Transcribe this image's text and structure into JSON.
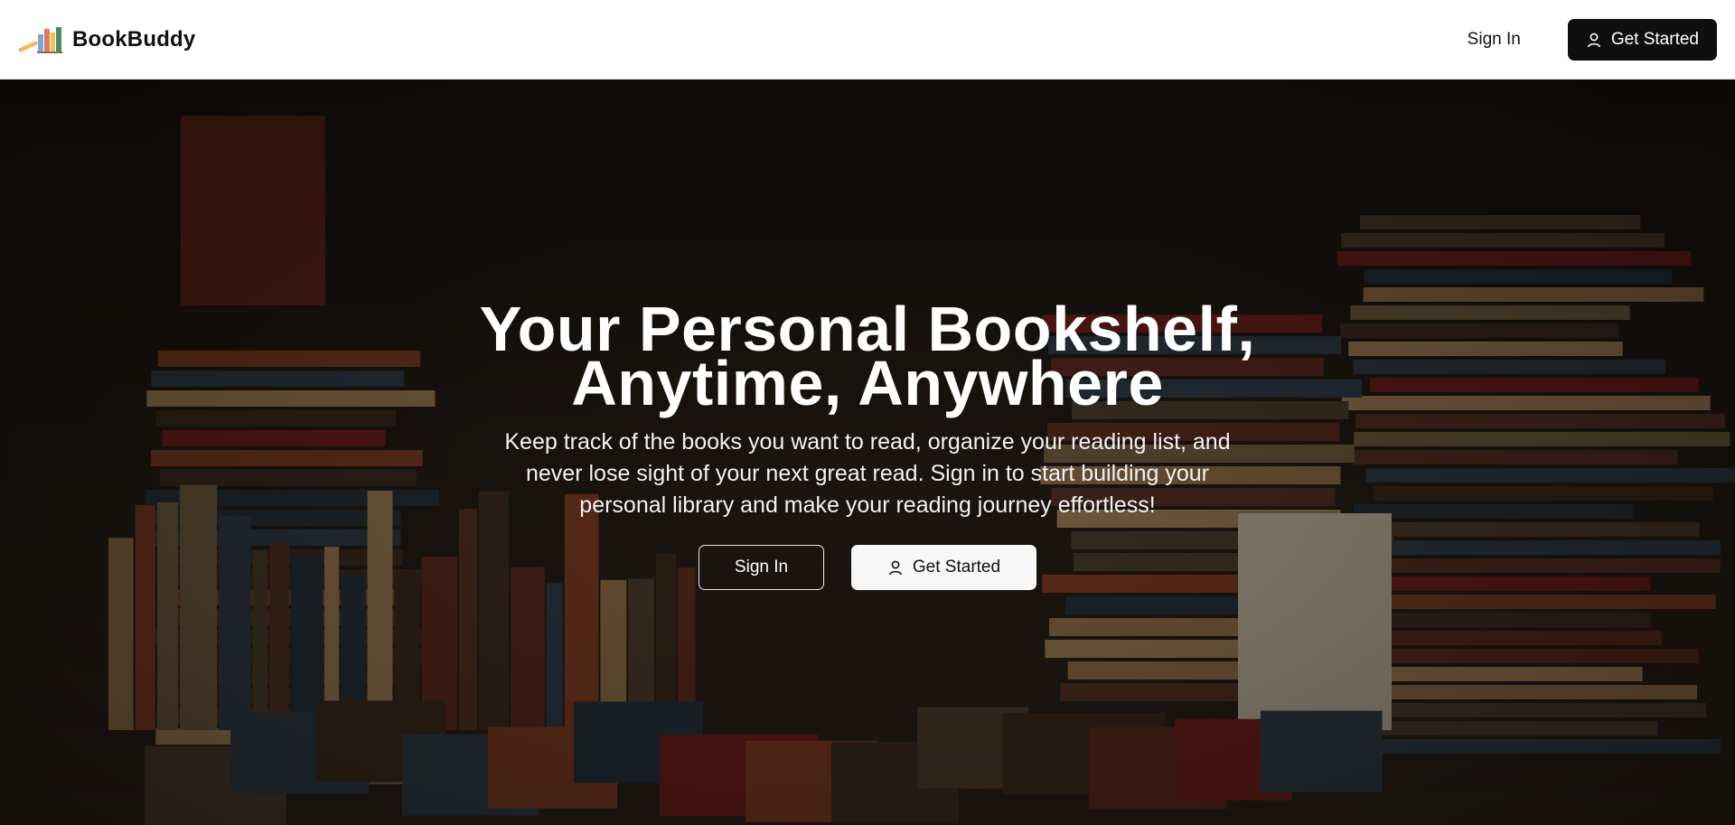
{
  "header": {
    "brand_name": "BookBuddy",
    "logo_icon": "books-logo-icon",
    "sign_in_label": "Sign In",
    "get_started_label": "Get Started",
    "get_started_icon": "user-icon"
  },
  "hero": {
    "title": "Your Personal Bookshelf, Anytime, Anywhere",
    "subtitle": "Keep track of the books you want to read, organize your reading list, and never lose sight of your next great read. Sign in to start building your personal library and make your reading journey effortless!",
    "sign_in_label": "Sign In",
    "get_started_label": "Get Started",
    "get_started_icon": "user-icon",
    "background": "bookshelf-photo"
  },
  "colors": {
    "primary_dark": "#0f0f0f",
    "hero_text": "#ffffff",
    "light_button": "#f7f7f7"
  }
}
